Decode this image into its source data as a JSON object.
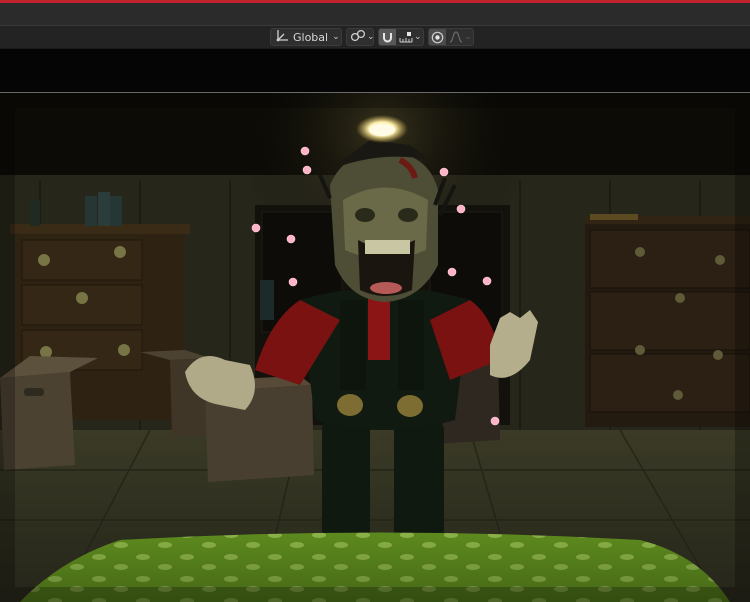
{
  "header": {
    "transform_orientation": {
      "label": "Global",
      "icon": "orientation-axes-icon"
    },
    "pivot_point": {
      "icon": "pivot-link-icon"
    },
    "snapping": {
      "icon": "snap-magnet-icon",
      "increment_icon": "snap-increment-icon"
    },
    "proportional_editing": {
      "icon": "proportional-edit-icon",
      "falloff_icon": "falloff-curve-icon"
    }
  },
  "colors": {
    "header_top_strip": "#c0222b",
    "header_bg": "#232323",
    "viewport_separator": "#6a6a6a",
    "light_marker": "#ffb3c6",
    "bedspread_green": "#5d8a1e",
    "character_shirt_red": "#7a1212"
  }
}
